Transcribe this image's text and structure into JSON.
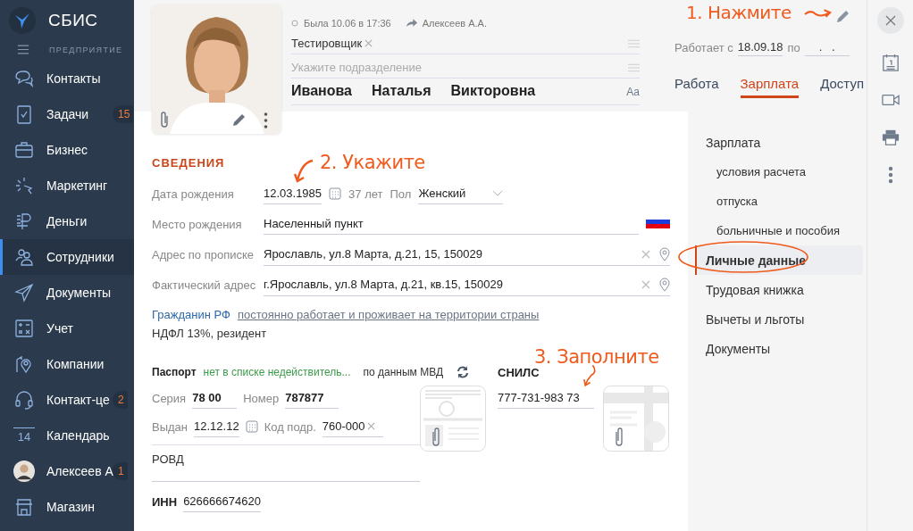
{
  "sidebar": {
    "logo": "СБИС",
    "section": "ПРЕДПРИЯТИЕ",
    "items": [
      {
        "label": "Контакты",
        "kind": "chat",
        "selected": false
      },
      {
        "label": "Задачи",
        "kind": "task",
        "badge": "15",
        "selected": false
      },
      {
        "label": "Бизнес",
        "kind": "case",
        "selected": false
      },
      {
        "label": "Маркетинг",
        "kind": "cursor",
        "selected": false
      },
      {
        "label": "Деньги",
        "kind": "ruble",
        "selected": false
      },
      {
        "label": "Сотрудники",
        "kind": "people",
        "selected": true
      },
      {
        "label": "Документы",
        "kind": "plane",
        "selected": false
      },
      {
        "label": "Учет",
        "kind": "calc",
        "selected": false
      },
      {
        "label": "Компании",
        "kind": "pin",
        "selected": false
      },
      {
        "label": "Контакт-це",
        "kind": "headset",
        "badge": "2",
        "selected": false
      },
      {
        "label": "Календарь",
        "kind": "date",
        "date": "14",
        "selected": false
      },
      {
        "label": "Алексеев А",
        "kind": "avatar",
        "badge": "1",
        "selected": false
      },
      {
        "label": "Магазин",
        "kind": "shop",
        "selected": false
      }
    ]
  },
  "profile": {
    "status": "Была 10.06 в 17:36",
    "forwarded_by": "Алексеев А.А.",
    "position": "Тестировщик",
    "department_placeholder": "Укажите подразделение",
    "last_name": "Иванова",
    "first_name": "Наталья",
    "middle_name": "Викторовна",
    "font_button": "Aa",
    "works_from_label": "Работает с",
    "works_from": "18.09.18",
    "works_to_label": "по",
    "works_to": ".   ."
  },
  "tabs": [
    {
      "label": "Работа",
      "selected": false
    },
    {
      "label": "Зарплата",
      "selected": true
    },
    {
      "label": "Доступ",
      "selected": false
    }
  ],
  "section_title": "СВЕДЕНИЯ",
  "birth": {
    "label": "Дата рождения",
    "date": "12.03.1985",
    "age": "37 лет",
    "gender_label": "Пол",
    "gender": "Женский"
  },
  "birthplace": {
    "label": "Место рождения",
    "placeholder": "Населенный пункт"
  },
  "addresses": [
    {
      "label": "Адрес по прописке",
      "value": "Ярославль, ул.8 Марта, д.21, 15, 150029"
    },
    {
      "label": "Фактический адрес",
      "value": "г.Ярославль, ул.8 Марта, д.21, кв.15, 150029"
    }
  ],
  "citizenship": {
    "label": "Гражданин РФ",
    "link": "постоянно работает и проживает на территории страны",
    "tax": "НДФЛ 13%, резидент"
  },
  "passport": {
    "title": "Паспорт",
    "check": "нет в списке недействитель...",
    "source": "по данным МВД",
    "series_label": "Серия",
    "series": "78 00",
    "number_label": "Номер",
    "number": "787877",
    "issued_label": "Выдан",
    "issued": "12.12.12",
    "code_label": "Код подр.",
    "code": "760-000",
    "issuer": "РОВД"
  },
  "snils": {
    "title": "СНИЛС",
    "value": "777-731-983 73"
  },
  "inn": {
    "label": "ИНН",
    "value": "626666674620"
  },
  "nav": [
    {
      "label": "Зарплата",
      "sub": false,
      "selected": false
    },
    {
      "label": "условия расчета",
      "sub": true,
      "selected": false
    },
    {
      "label": "отпуска",
      "sub": true,
      "selected": false
    },
    {
      "label": "больничные и пособия",
      "sub": true,
      "selected": false
    },
    {
      "label": "Личные данные",
      "sub": false,
      "selected": true
    },
    {
      "label": "Трудовая книжка",
      "sub": false,
      "selected": false
    },
    {
      "label": "Вычеты и льготы",
      "sub": false,
      "selected": false
    },
    {
      "label": "Документы",
      "sub": false,
      "selected": false
    }
  ],
  "annotations": [
    {
      "text": "1. Нажмите"
    },
    {
      "text": "2. Укажите"
    },
    {
      "text": "3. Заполните"
    }
  ]
}
